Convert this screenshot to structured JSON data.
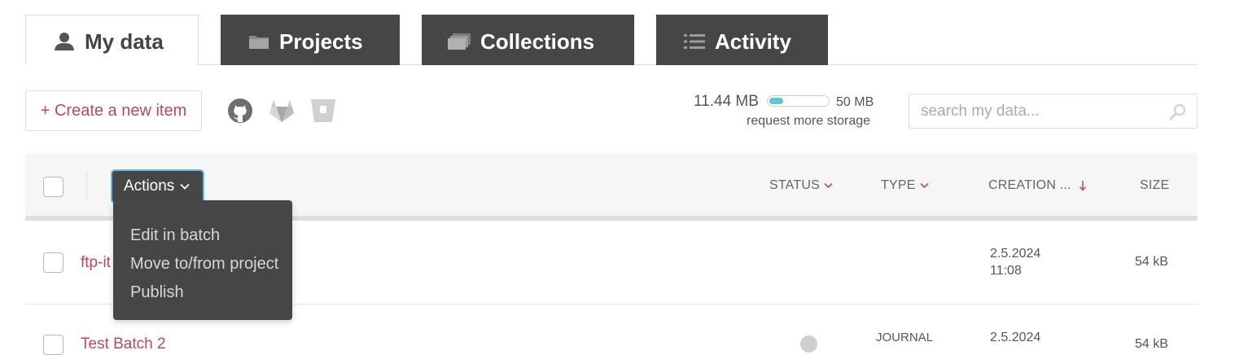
{
  "tabs": [
    {
      "label": "My data",
      "icon": "user-icon",
      "active": true
    },
    {
      "label": "Projects",
      "icon": "folder-icon",
      "active": false
    },
    {
      "label": "Collections",
      "icon": "stack-icon",
      "active": false
    },
    {
      "label": "Activity",
      "icon": "list-icon",
      "active": false
    }
  ],
  "toolbar": {
    "create_label": "+ Create a new item",
    "repo_icons": [
      "github-icon",
      "gitlab-icon",
      "bitbucket-icon"
    ]
  },
  "storage": {
    "used": "11.44 MB",
    "max": "50 MB",
    "used_fraction": 0.23,
    "request_label": "request more storage"
  },
  "search": {
    "placeholder": "search my data..."
  },
  "table": {
    "actions_label": "Actions",
    "actions_menu": [
      "Edit in batch",
      "Move to/from project",
      "Publish"
    ],
    "columns": {
      "status": "STATUS",
      "type": "TYPE",
      "creation": "CREATION ...",
      "size": "SIZE"
    },
    "rows": [
      {
        "title": "ftp-it",
        "type": "",
        "date": "2.5.2024",
        "time": "11:08",
        "size": "54 kB"
      },
      {
        "title": "Test Batch 2",
        "type": "JOURNAL",
        "date": "2.5.2024",
        "time": "",
        "size": "54 kB"
      }
    ]
  },
  "colors": {
    "accent": "#b94a58",
    "dark_tab": "#464646",
    "storage_fill": "#5bc8d0",
    "focus_ring": "#66b8ee"
  }
}
